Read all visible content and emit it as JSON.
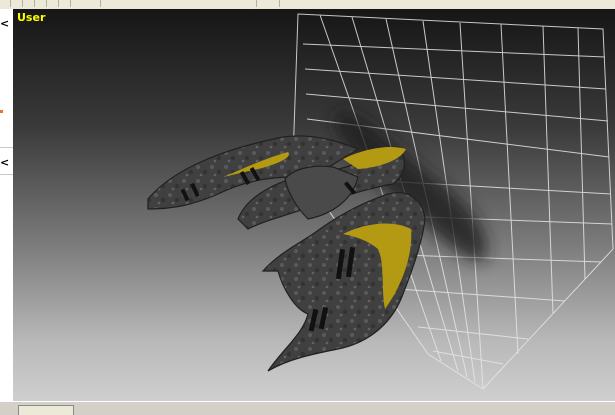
{
  "viewport": {
    "label": "User",
    "label_color": "#ffff00"
  },
  "left_panel": {
    "collapse_glyph": "<"
  },
  "model": {
    "hull_color": "#3e3e3e",
    "stripe_color": "#b49a12",
    "grid_color": "#e6e6e6"
  }
}
